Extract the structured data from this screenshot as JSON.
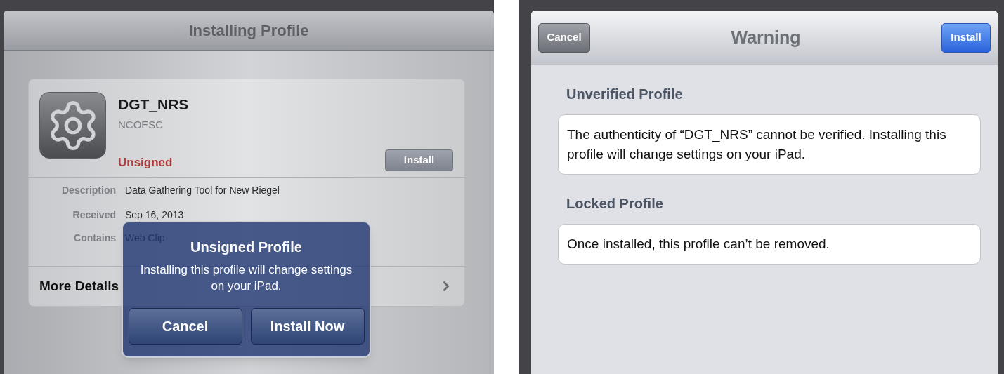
{
  "left_screen": {
    "title": "Installing Profile",
    "profile": {
      "name": "DGT_NRS",
      "organization": "NCOESC",
      "status": "Unsigned",
      "signed": false,
      "install_button": "Install"
    },
    "details": [
      {
        "label": "Description",
        "value": "Data Gathering Tool for New Riegel"
      },
      {
        "label": "Received",
        "value": "Sep 16, 2013"
      },
      {
        "label": "Contains",
        "value": "Web Clip"
      }
    ],
    "more_details": "More Details",
    "alert": {
      "title": "Unsigned Profile",
      "message": "Installing this profile will change settings on your iPad.",
      "buttons": [
        "Cancel",
        "Install Now"
      ]
    }
  },
  "right_screen": {
    "title": "Warning",
    "cancel_button": "Cancel",
    "install_button": "Install",
    "sections": [
      {
        "heading": "Unverified Profile",
        "text": "The authenticity of “DGT_NRS” cannot be verified. Installing this profile will change settings on your iPad."
      },
      {
        "heading": "Locked Profile",
        "text": "Once installed, this profile can’t be removed."
      }
    ]
  }
}
